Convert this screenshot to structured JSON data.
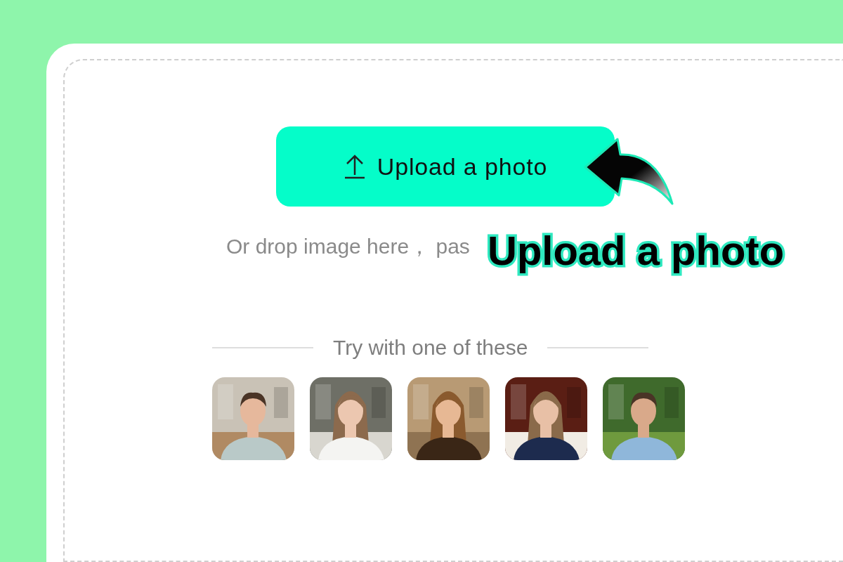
{
  "upload_button": {
    "label": "Upload a photo"
  },
  "hint": "Or drop image here， pas",
  "callout": {
    "label": "Upload a photo"
  },
  "samples": {
    "heading": "Try with one of these"
  }
}
